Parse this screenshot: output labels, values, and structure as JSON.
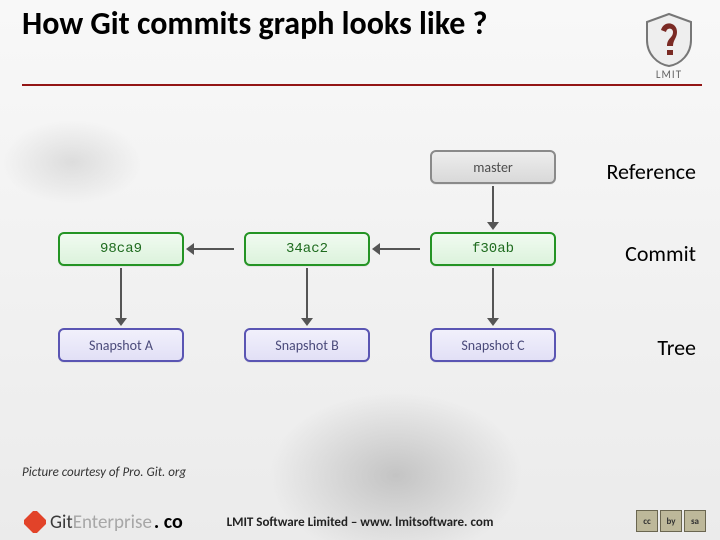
{
  "title": "How Git commits graph looks like ?",
  "logo_text": "LMIT",
  "labels": {
    "reference": "Reference",
    "commit": "Commit",
    "tree": "Tree"
  },
  "diagram": {
    "reference": {
      "label": "master"
    },
    "commits": [
      {
        "sha": "98ca9"
      },
      {
        "sha": "34ac2"
      },
      {
        "sha": "f30ab"
      }
    ],
    "trees": [
      {
        "label": "Snapshot A"
      },
      {
        "label": "Snapshot B"
      },
      {
        "label": "Snapshot C"
      }
    ]
  },
  "courtesy": "Picture courtesy of  Pro. Git. org",
  "footer": {
    "brand_git": "Git",
    "brand_ent": "Enterprise",
    "brand_dotcom": ". co",
    "center": "LMIT Software Limited – www. lmitsoftware. com"
  },
  "cc": [
    "cc",
    "by",
    "sa"
  ]
}
